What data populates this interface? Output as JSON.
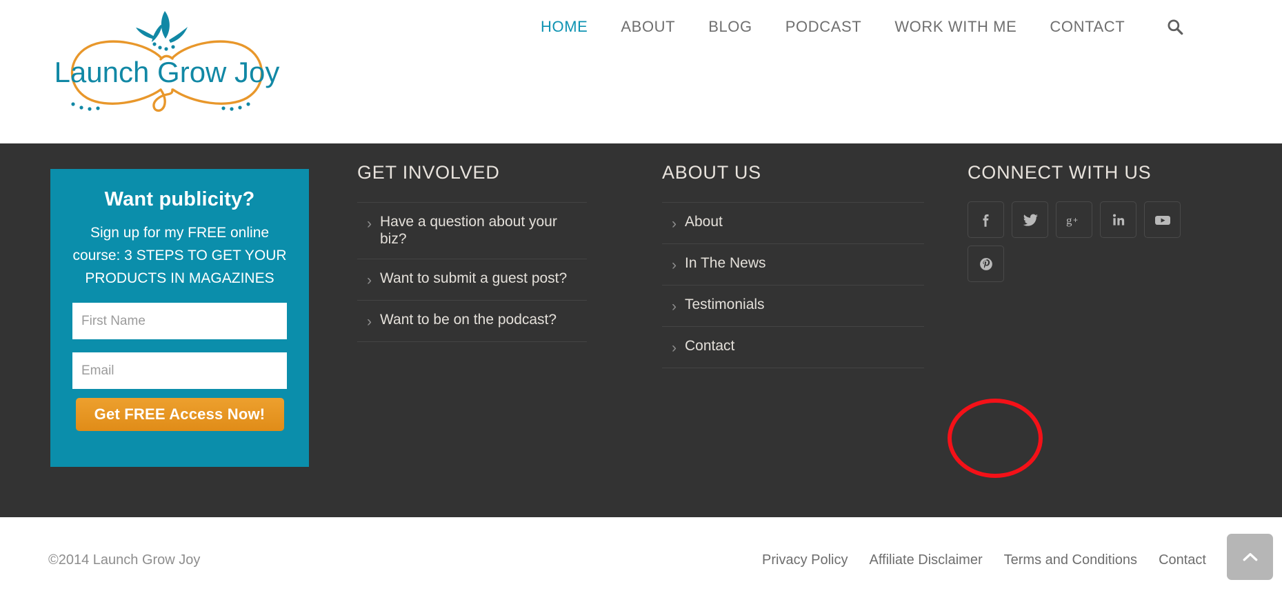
{
  "header": {
    "logo": {
      "name": "launch-grow-joy-logo",
      "text": "Launch Grow Joy",
      "text_color": "#1188a5",
      "ribbon_color": "#e8972b"
    },
    "nav": {
      "items": [
        {
          "label": "HOME",
          "active": true
        },
        {
          "label": "ABOUT",
          "active": false
        },
        {
          "label": "BLOG",
          "active": false
        },
        {
          "label": "PODCAST",
          "active": false
        },
        {
          "label": "WORK WITH ME",
          "active": false
        },
        {
          "label": "CONTACT",
          "active": false
        }
      ],
      "active_color": "#0e93b2",
      "inactive_color": "#6f6f6f",
      "search_icon": "search-icon"
    }
  },
  "footer": {
    "background": "#333333",
    "optin": {
      "background": "#0b8eab",
      "title": "Want publicity?",
      "subtitle": "Sign up for my FREE online course: 3 STEPS TO GET YOUR PRODUCTS IN MAGAZINES",
      "first_name_placeholder": "First Name",
      "first_name_value": "",
      "email_placeholder": "Email",
      "email_value": "",
      "button_label": "Get FREE Access Now!",
      "button_color": "#e59320"
    },
    "columns": [
      {
        "heading": "GET INVOLVED",
        "items": [
          "Have a question about your biz?",
          "Want to submit a guest post?",
          "Want to be on the podcast?"
        ]
      },
      {
        "heading": "ABOUT US",
        "items": [
          "About",
          "In The News",
          "Testimonials",
          "Contact"
        ]
      }
    ],
    "connect": {
      "heading": "CONNECT WITH US",
      "socials": [
        {
          "name": "facebook-icon",
          "label": "Facebook"
        },
        {
          "name": "twitter-icon",
          "label": "Twitter"
        },
        {
          "name": "google-plus-icon",
          "label": "Google Plus"
        },
        {
          "name": "linkedin-icon",
          "label": "LinkedIn"
        },
        {
          "name": "youtube-icon",
          "label": "YouTube"
        },
        {
          "name": "pinterest-icon",
          "label": "Pinterest"
        }
      ]
    },
    "annotation": {
      "target": "pinterest-icon",
      "color": "#f41118",
      "shape": "ellipse"
    }
  },
  "bottom_bar": {
    "copyright": "©2014 Launch Grow Joy",
    "links": [
      "Privacy Policy",
      "Affiliate Disclaimer",
      "Terms and Conditions",
      "Contact"
    ],
    "to_top_icon": "chevron-up-icon"
  }
}
